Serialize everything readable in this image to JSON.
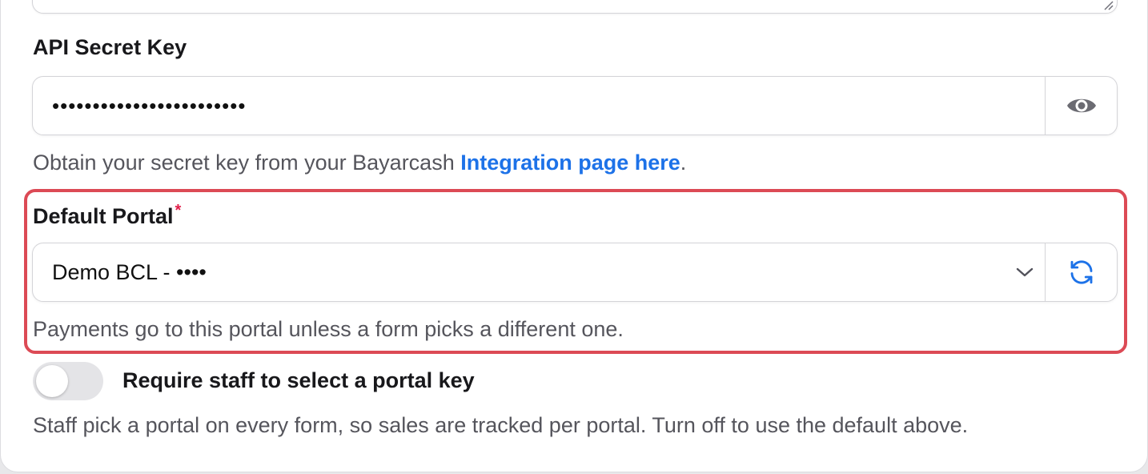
{
  "api_secret": {
    "label": "API Secret Key",
    "masked_value": "••••••••••••••••••••••••",
    "help_prefix": "Obtain your secret key from your Bayarcash ",
    "help_link": "Integration page here",
    "help_suffix": "."
  },
  "default_portal": {
    "label": "Default Portal",
    "required_marker": "*",
    "selected_value": "Demo BCL - ••••",
    "help": "Payments go to this portal unless a form picks a different one."
  },
  "require_portal_toggle": {
    "label": "Require staff to select a portal key",
    "enabled": false,
    "help": "Staff pick a portal on every form, so sales are tracked per portal. Turn off to use the default above."
  },
  "colors": {
    "accent": "#1d72e8",
    "highlight_border": "#dc4a55",
    "required": "#e11d48"
  },
  "icons": {
    "reveal": "eye-icon",
    "dropdown": "chevron-down-icon",
    "refresh": "refresh-icon",
    "resize": "resize-grip-icon"
  }
}
